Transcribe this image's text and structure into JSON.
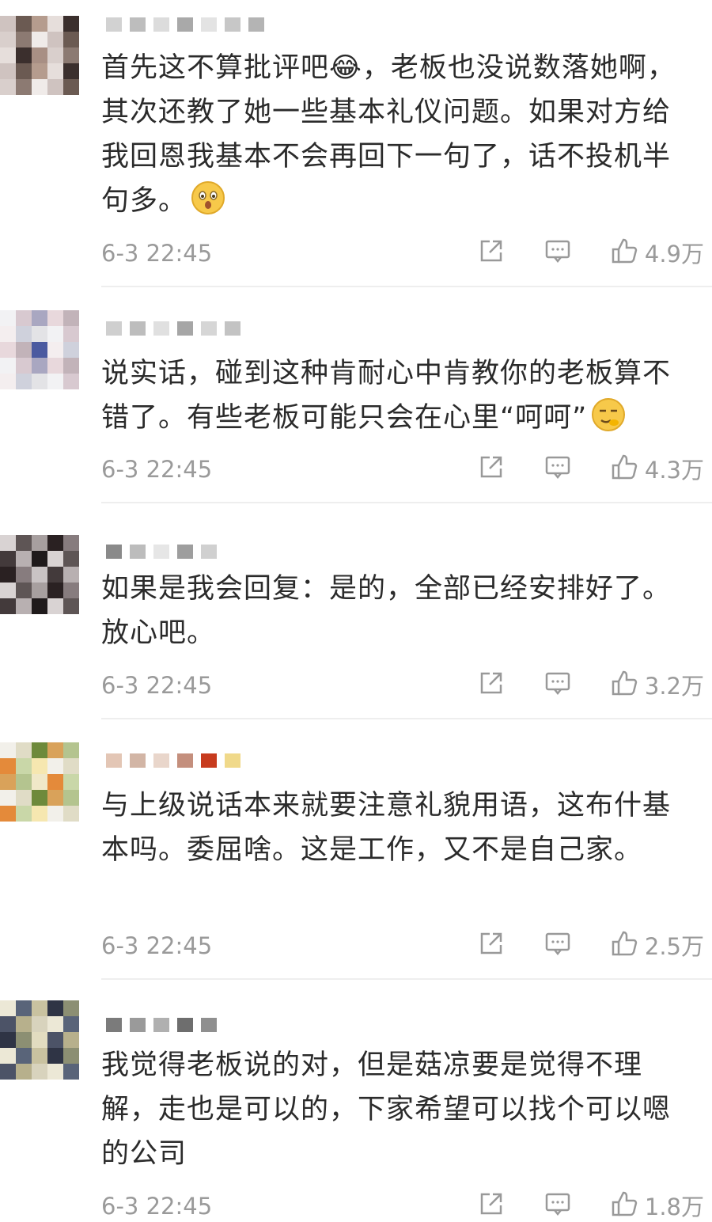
{
  "comments": [
    {
      "text": "首先这不算批评吧😂，老板也没说数落她啊，其次还教了她一些基本礼仪问题。如果对方给我回恩我基本不会再回下一句了，话不投机半句多。",
      "emoji": "sad-face-emoji",
      "time": "6-3 22:45",
      "likes": "4.9万",
      "avatar_colors": [
        "#cfc3c0",
        "#6b5a52",
        "#b59c8e",
        "#e6dedb",
        "#3b2f2d",
        "#a88f84",
        "#d9cfcc",
        "#8c7a72",
        "#f0ebe9"
      ],
      "name_colors": [
        "#d2d2d2",
        "#bdbdbd",
        "#dcdcdc",
        "#a9a9a9",
        "#e3e3e3",
        "#c7c7c7",
        "#b4b4b4"
      ]
    },
    {
      "text": "说实话，碰到这种肯耐心中肯教你的老板算不错了。有些老板可能只会在心里“呵呵”",
      "emoji": "smirk-emoji",
      "time": "6-3 22:45",
      "likes": "4.3万",
      "avatar_colors": [
        "#f2f2f4",
        "#d8c9d0",
        "#a9a7c1",
        "#e8d8dc",
        "#c2b3b9",
        "#4b5aa0",
        "#f4eeef",
        "#cfd1dc",
        "#e3e3e6"
      ],
      "name_colors": [
        "#cfcfcf",
        "#bdbdbd",
        "#e0e0e0",
        "#a6a6a6",
        "#d6d6d6",
        "#c3c3c3"
      ]
    },
    {
      "text": "如果是我会回复：是的，全部已经安排好了。放心吧。",
      "emoji": "",
      "time": "6-3 22:45",
      "likes": "3.2万",
      "avatar_colors": [
        "#d9d3d3",
        "#5e5555",
        "#a79f9f",
        "#2a2122",
        "#877c7e",
        "#c9c3c4",
        "#433a3b",
        "#b8b0b1",
        "#1f1a1b"
      ],
      "name_colors": [
        "#8a8a8a",
        "#bcbcbc",
        "#e6e6e6",
        "#9e9e9e",
        "#d0d0d0"
      ]
    },
    {
      "text": "与上级说话本来就要注意礼貌用语，这布什基本吗。委屈啥。这是工作，又不是自己家。",
      "emoji": "",
      "time": "6-3 22:45",
      "likes": "2.5万",
      "avatar_colors": [
        "#f2f0ea",
        "#e0dcc6",
        "#6e8a3b",
        "#d9a25a",
        "#b4c48f",
        "#f0e8c8",
        "#e48a3a",
        "#c9d7a8",
        "#f6e7b0"
      ],
      "name_colors": [
        "#e3c6b5",
        "#d2b5a5",
        "#e9d6cb",
        "#c48f7d",
        "#c73b1e",
        "#f0d98a"
      ]
    },
    {
      "text": "我觉得老板说的对，但是菇凉要是觉得不理解，走也是可以的，下家希望可以找个可以嗯的公司",
      "emoji": "",
      "time": "6-3 22:45",
      "likes": "1.8万",
      "avatar_colors": [
        "#ece8d6",
        "#596479",
        "#c9c2a0",
        "#2f3445",
        "#8c8f73",
        "#e2dcc0",
        "#4c5367",
        "#b7b08c",
        "#d8d3bd"
      ],
      "name_colors": [
        "#7b7b7b",
        "#9a9a9a",
        "#b0b0b0",
        "#6e6e6e",
        "#8f8f8f"
      ]
    }
  ]
}
